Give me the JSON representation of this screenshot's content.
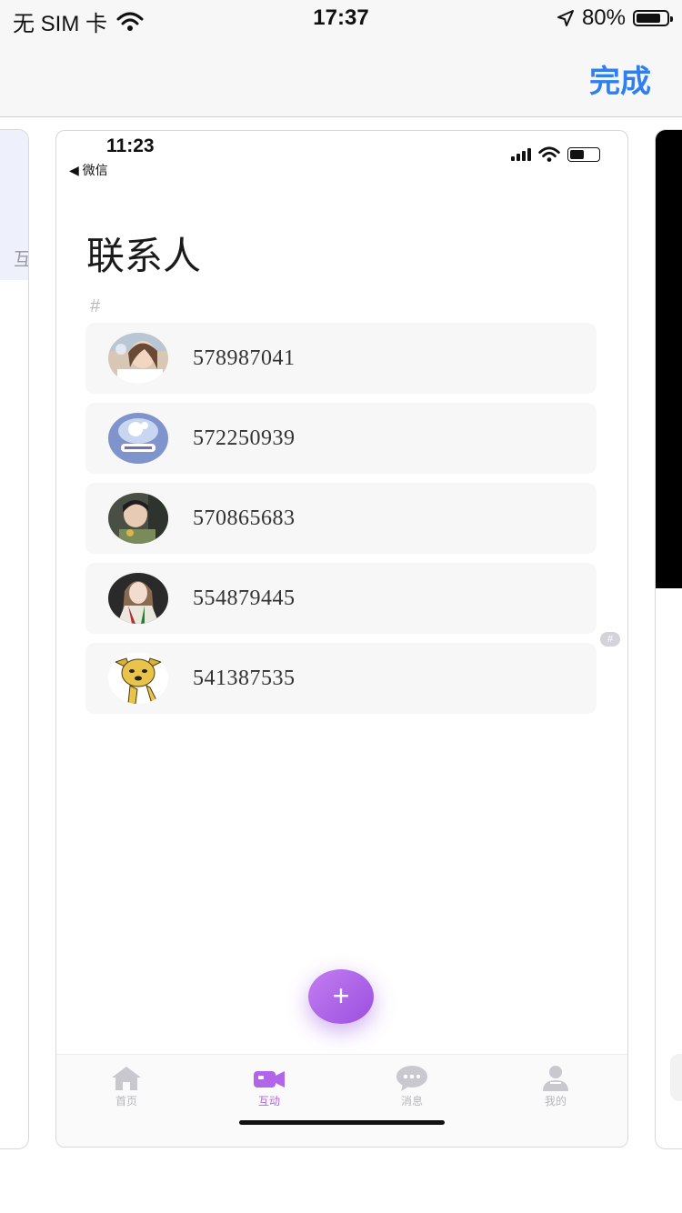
{
  "status_bar": {
    "carrier": "无 SIM 卡",
    "time": "17:37",
    "battery": "80%",
    "battery_level": 0.8
  },
  "nav": {
    "done_label": "完成"
  },
  "side_card_left": {
    "partial_text": "互"
  },
  "inner_status": {
    "time": "11:23",
    "back_label": "◀ 微信",
    "battery_level": 0.5
  },
  "page": {
    "title": "联系人",
    "section_header": "#",
    "index_letter": "#"
  },
  "contacts": [
    {
      "id": "578987041",
      "avatar": "avatar-woman-photo"
    },
    {
      "id": "572250939",
      "avatar": "avatar-cartoon-sticker"
    },
    {
      "id": "570865683",
      "avatar": "avatar-child-photo"
    },
    {
      "id": "554879445",
      "avatar": "avatar-woman-scarf-photo"
    },
    {
      "id": "541387535",
      "avatar": "avatar-cartoon-dog"
    }
  ],
  "fab": {
    "label": "+"
  },
  "tabs": [
    {
      "label": "首页",
      "icon": "home-icon"
    },
    {
      "label": "互动",
      "icon": "video-camera-icon",
      "active": true
    },
    {
      "label": "消息",
      "icon": "chat-bubble-icon"
    },
    {
      "label": "我的",
      "icon": "user-icon"
    }
  ],
  "colors": {
    "accent": "#b265e8",
    "link_blue": "#2f7ff0",
    "row_bg": "#f7f7f7"
  }
}
